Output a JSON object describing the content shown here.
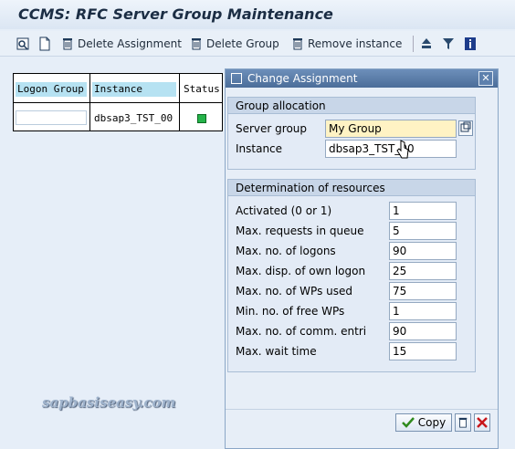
{
  "window": {
    "title": "CCMS: RFC Server Group Maintenance"
  },
  "toolbar": {
    "delete_assignment": "Delete Assignment",
    "delete_group": "Delete Group",
    "remove_instance": "Remove instance"
  },
  "list": {
    "columns": [
      "Logon Group",
      "Instance",
      "Status"
    ],
    "rows": [
      {
        "logon_group": "",
        "instance": "dbsap3_TST_00",
        "status_color": "#25b34a"
      }
    ]
  },
  "dialog": {
    "title": "Change Assignment",
    "group_allocation": {
      "header": "Group allocation",
      "server_group_label": "Server group",
      "server_group_value": "My Group",
      "instance_label": "Instance",
      "instance_value": "dbsap3_TST_00"
    },
    "resources": {
      "header": "Determination of resources",
      "rows": [
        {
          "label": "Activated (0 or 1)",
          "value": "1"
        },
        {
          "label": "Max. requests in queue",
          "value": "5"
        },
        {
          "label": "Max. no. of logons",
          "value": "90"
        },
        {
          "label": "Max. disp. of own logon",
          "value": "25"
        },
        {
          "label": "Max. no. of WPs used",
          "value": "75"
        },
        {
          "label": "Min. no. of free WPs",
          "value": "1"
        },
        {
          "label": "Max. no. of comm. entri",
          "value": "90"
        },
        {
          "label": "Max. wait time",
          "value": "15"
        }
      ]
    },
    "buttons": {
      "copy": "Copy"
    }
  },
  "watermark": "sapbasiseasy.com"
}
